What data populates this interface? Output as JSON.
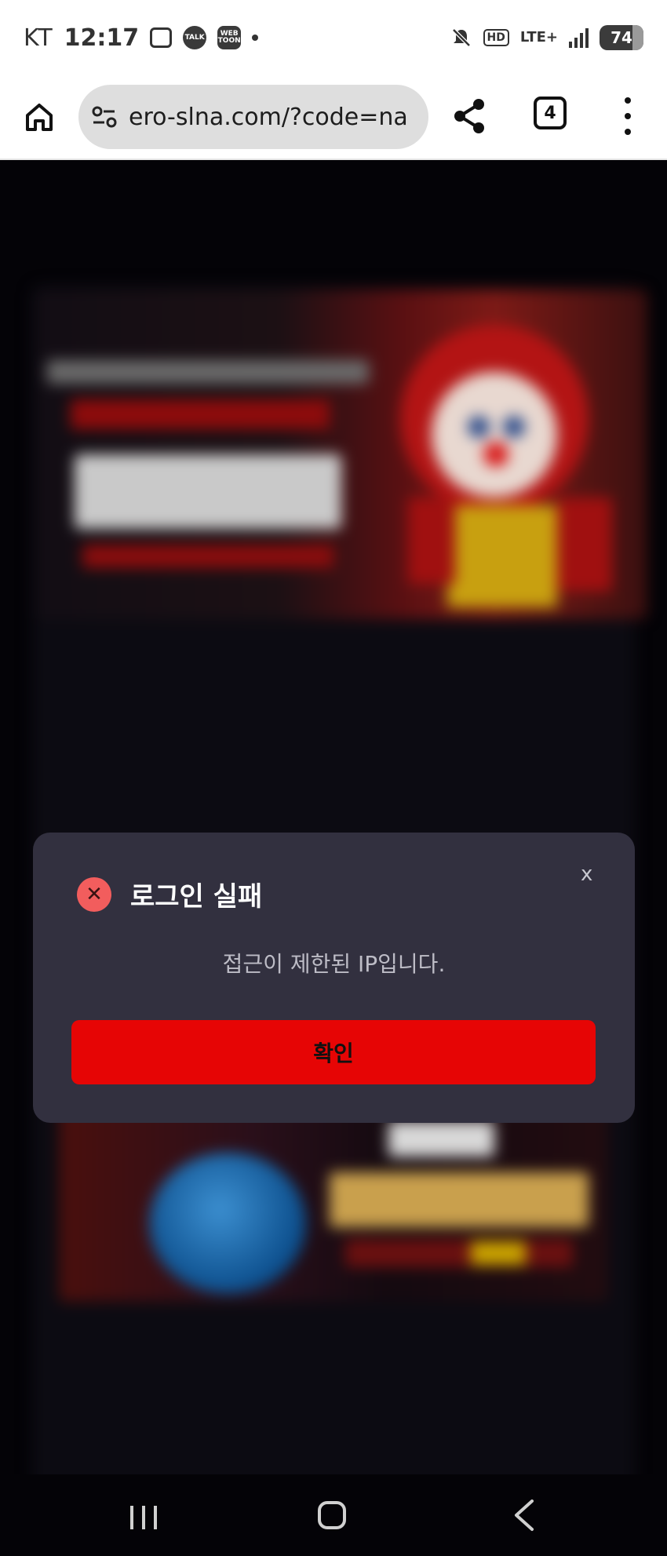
{
  "status_bar": {
    "carrier": "KT",
    "time": "12:17",
    "app_icons": [
      {
        "name": "screenshot-icon",
        "label": ""
      },
      {
        "name": "kakaotalk-icon",
        "label": "TALK"
      },
      {
        "name": "webtoon-icon",
        "label": "WEB TOON"
      }
    ],
    "hd_label": "HD",
    "network_label": "LTE+",
    "battery_level": "74"
  },
  "browser": {
    "url": "ero-slna.com/?code=na",
    "tab_count": "4"
  },
  "modal": {
    "title": "로그인 실패",
    "close_label": "x",
    "message": "접근이 제한된 IP입니다.",
    "confirm_label": "확인",
    "error_color": "#f25d5d",
    "button_color": "#e60505"
  }
}
